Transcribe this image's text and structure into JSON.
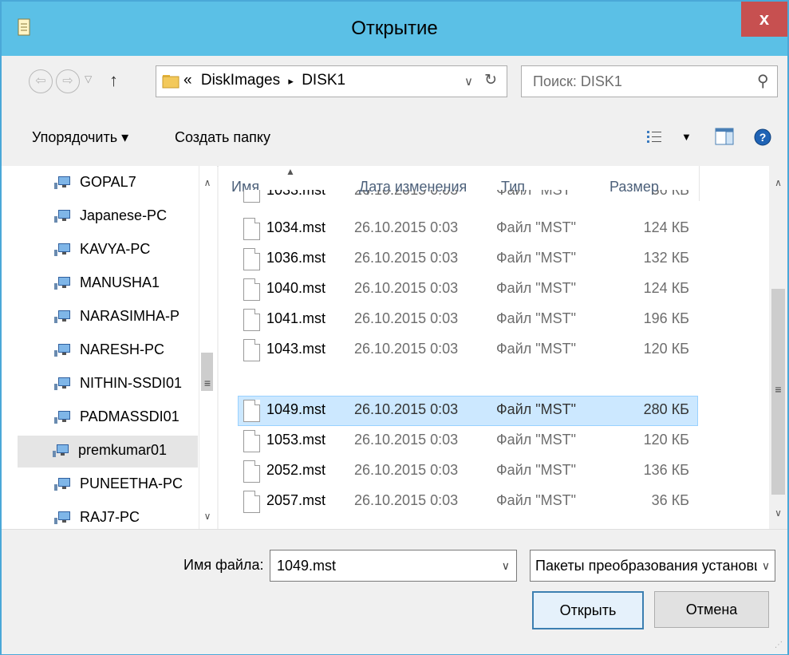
{
  "window": {
    "title": "Открытие",
    "close_label": "x"
  },
  "address": {
    "path_prefix": "«",
    "crumbs": [
      "DiskImages",
      "DISK1"
    ],
    "separator": "▸",
    "search_placeholder": "Поиск: DISK1"
  },
  "toolbar": {
    "organize_label": "Упорядочить ▾",
    "new_folder_label": "Создать папку"
  },
  "nav": {
    "items": [
      {
        "label": "GOPAL7"
      },
      {
        "label": "Japanese-PC"
      },
      {
        "label": "KAVYA-PC"
      },
      {
        "label": "MANUSHA1"
      },
      {
        "label": "NARASIMHA-P"
      },
      {
        "label": "NARESH-PC"
      },
      {
        "label": "NITHIN-SSDI01"
      },
      {
        "label": "PADMASSDI01"
      },
      {
        "label": "premkumar01"
      },
      {
        "label": "PUNEETHA-PC"
      },
      {
        "label": "RAJ7-PC"
      }
    ],
    "selected_index": 8
  },
  "files": {
    "columns": {
      "name": "Имя",
      "date": "Дата изменения",
      "type": "Тип",
      "size": "Размер"
    },
    "rows": [
      {
        "name": "1033.mst",
        "date": "26.10.2015 0:03",
        "type": "Файл \"MST\"",
        "size": "36 КБ"
      },
      {
        "name": "1034.mst",
        "date": "26.10.2015 0:03",
        "type": "Файл \"MST\"",
        "size": "124 КБ"
      },
      {
        "name": "1036.mst",
        "date": "26.10.2015 0:03",
        "type": "Файл \"MST\"",
        "size": "132 КБ"
      },
      {
        "name": "1040.mst",
        "date": "26.10.2015 0:03",
        "type": "Файл \"MST\"",
        "size": "124 КБ"
      },
      {
        "name": "1041.mst",
        "date": "26.10.2015 0:03",
        "type": "Файл \"MST\"",
        "size": "196 КБ"
      },
      {
        "name": "1043.mst",
        "date": "26.10.2015 0:03",
        "type": "Файл \"MST\"",
        "size": "120 КБ"
      },
      {
        "name": "1049.mst",
        "date": "26.10.2015 0:03",
        "type": "Файл \"MST\"",
        "size": "280 КБ"
      },
      {
        "name": "1053.mst",
        "date": "26.10.2015 0:03",
        "type": "Файл \"MST\"",
        "size": "120 КБ"
      },
      {
        "name": "2052.mst",
        "date": "26.10.2015 0:03",
        "type": "Файл \"MST\"",
        "size": "136 КБ"
      },
      {
        "name": "2057.mst",
        "date": "26.10.2015 0:03",
        "type": "Файл \"MST\"",
        "size": "36 КБ"
      }
    ],
    "selected_index": 6
  },
  "footer": {
    "filename_label": "Имя файла:",
    "filename_value": "1049.mst",
    "filetype_value": "Пакеты преобразования установщика",
    "open_label": "Открыть",
    "cancel_label": "Отмена"
  },
  "colors": {
    "titlebar": "#5bc0e6",
    "close": "#c75050",
    "selection": "#cce8ff"
  }
}
